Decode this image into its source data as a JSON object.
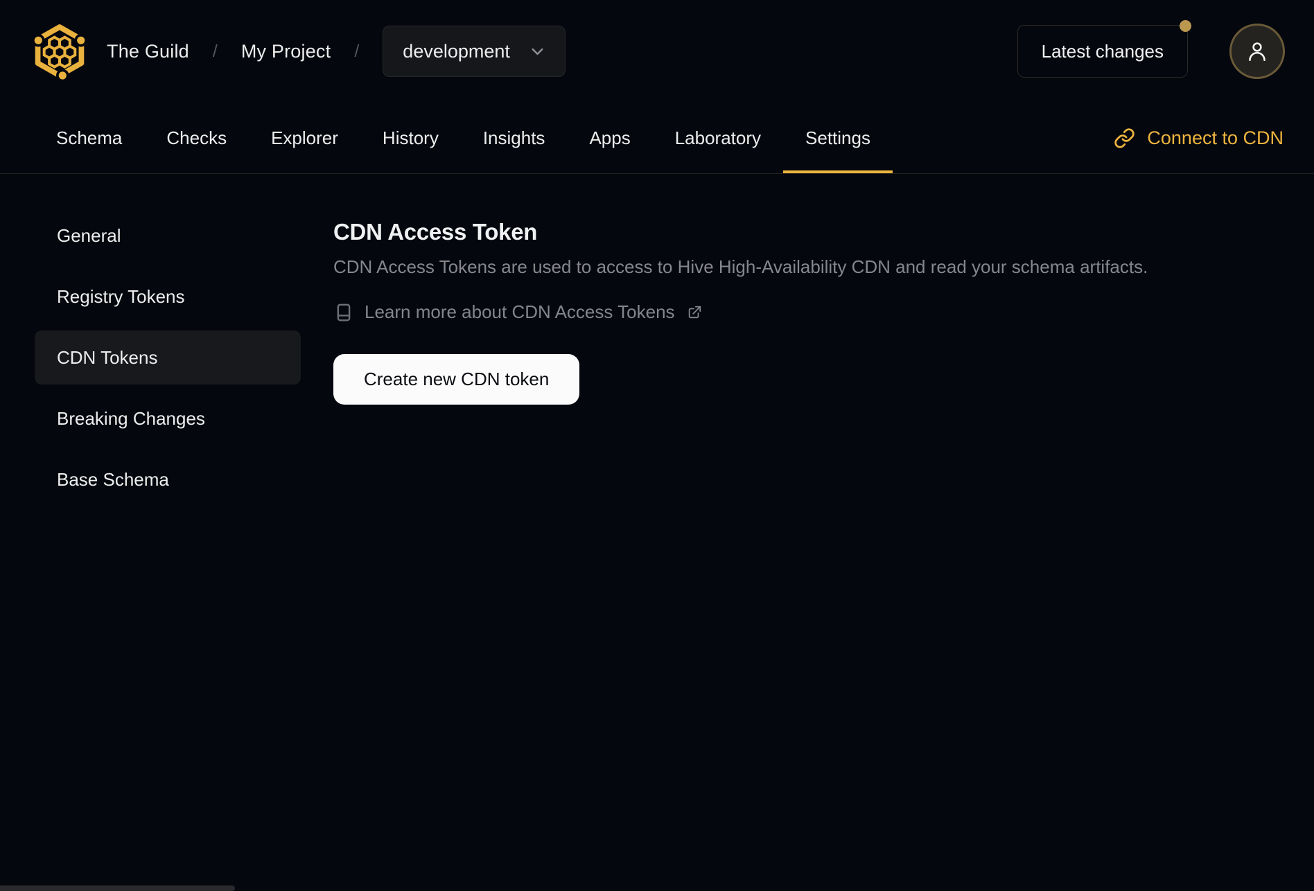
{
  "header": {
    "breadcrumb": {
      "org": "The Guild",
      "project": "My Project",
      "separator": "/"
    },
    "target_selector": {
      "value": "development"
    },
    "latest_changes_label": "Latest changes"
  },
  "tabs": [
    {
      "label": "Schema",
      "active": false
    },
    {
      "label": "Checks",
      "active": false
    },
    {
      "label": "Explorer",
      "active": false
    },
    {
      "label": "History",
      "active": false
    },
    {
      "label": "Insights",
      "active": false
    },
    {
      "label": "Apps",
      "active": false
    },
    {
      "label": "Laboratory",
      "active": false
    },
    {
      "label": "Settings",
      "active": true
    }
  ],
  "connect_cdn_label": "Connect to CDN",
  "sidebar": {
    "items": [
      {
        "label": "General",
        "active": false
      },
      {
        "label": "Registry Tokens",
        "active": false
      },
      {
        "label": "CDN Tokens",
        "active": true
      },
      {
        "label": "Breaking Changes",
        "active": false
      },
      {
        "label": "Base Schema",
        "active": false
      }
    ]
  },
  "main": {
    "title": "CDN Access Token",
    "description": "CDN Access Tokens are used to access to Hive High-Availability CDN and read your schema artifacts.",
    "learn_more_label": "Learn more about CDN Access Tokens",
    "create_button_label": "Create new CDN token"
  },
  "icons": {
    "logo": "hive-honeycomb-logo",
    "dropdown": "chevron-down-icon",
    "user": "user-icon",
    "connect": "link-icon",
    "learn_more_left": "book-icon",
    "learn_more_right": "external-link-icon"
  },
  "colors": {
    "background": "#05070e",
    "accent_gold": "#edb43e",
    "notification_dot": "#bb984f",
    "text_primary": "#eceded",
    "text_muted": "#85878c",
    "active_item_bg": "#18191c",
    "button_bg": "#fbfbfc",
    "button_text": "#0a0c11"
  }
}
